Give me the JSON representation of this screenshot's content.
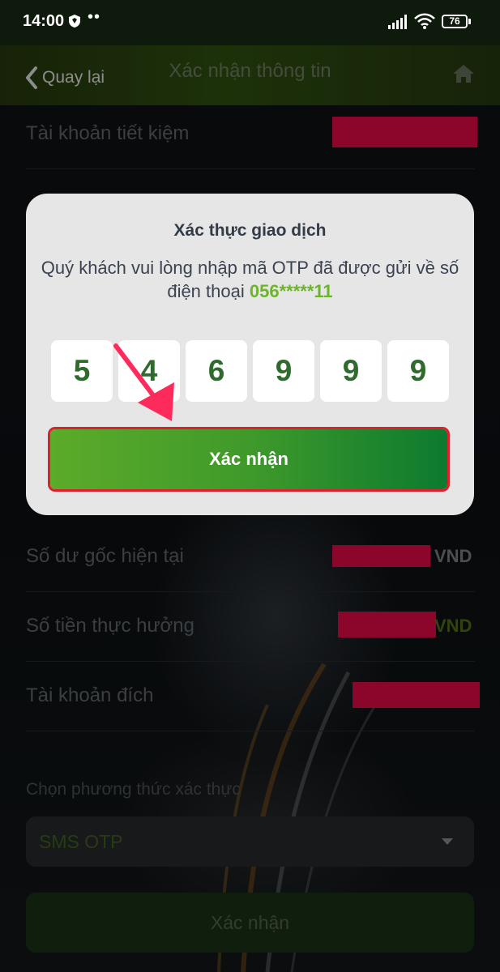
{
  "status_bar": {
    "time": "14:00",
    "dots": "••",
    "battery": "76"
  },
  "header": {
    "back_label": "Quay lại",
    "title": "Xác nhận thông tin"
  },
  "rows": [
    {
      "label": "Tài khoản tiết kiệm",
      "unit": ""
    },
    {
      "label": "Số dư gốc hiện tại",
      "unit": "VND"
    },
    {
      "label": "Số tiền thực hưởng",
      "unit": "VND"
    },
    {
      "label": "Tài khoản đích",
      "unit": ""
    }
  ],
  "verification": {
    "label": "Chọn phương thức xác thực",
    "selected": "SMS OTP"
  },
  "bottom_button": "Xác nhận",
  "dialog": {
    "title": "Xác thực giao dịch",
    "message": "Quý khách vui lòng nhập mã OTP đã được gửi về số điện thoại",
    "phone": "056*****11",
    "otp_digits": [
      "5",
      "4",
      "6",
      "9",
      "9",
      "9"
    ],
    "confirm_label": "Xác nhận"
  },
  "colors": {
    "header_green": "#355a12",
    "redaction": "#ff0a4e",
    "phone_green": "#6cb42a",
    "otp_digit": "#2f6b2c",
    "confirm_start": "#5cab2a",
    "confirm_end": "#0c7a2f",
    "highlight_outline": "#e01e2e",
    "arrow": "#ff2a5c"
  }
}
